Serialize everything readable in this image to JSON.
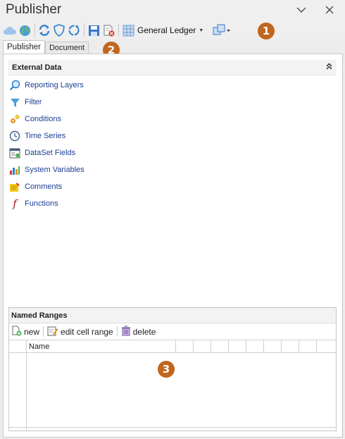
{
  "window": {
    "title": "Publisher"
  },
  "toolbar": {
    "ledger_label": "General Ledger"
  },
  "callouts": [
    "1",
    "2",
    "3"
  ],
  "tabs": [
    {
      "label": "Publisher",
      "active": true
    },
    {
      "label": "Document",
      "active": false
    }
  ],
  "external_data": {
    "title": "External Data",
    "items": [
      {
        "label": "Reporting Layers",
        "icon": "magnifier-icon"
      },
      {
        "label": "Filter",
        "icon": "filter-icon"
      },
      {
        "label": "Conditions",
        "icon": "conditions-icon"
      },
      {
        "label": "Time Series",
        "icon": "clock-icon"
      },
      {
        "label": "DataSet Fields",
        "icon": "dataset-icon"
      },
      {
        "label": "System Variables",
        "icon": "system-variables-icon"
      },
      {
        "label": "Comments",
        "icon": "comments-icon"
      },
      {
        "label": "Functions",
        "icon": "function-icon"
      }
    ]
  },
  "named_ranges": {
    "title": "Named Ranges",
    "new_label": "new",
    "edit_label": "edit cell range",
    "delete_label": "delete",
    "column_name": "Name"
  },
  "colors": {
    "link": "#1a3d94",
    "callout": "#c0661f",
    "accent_blue": "#2e7fd0"
  }
}
